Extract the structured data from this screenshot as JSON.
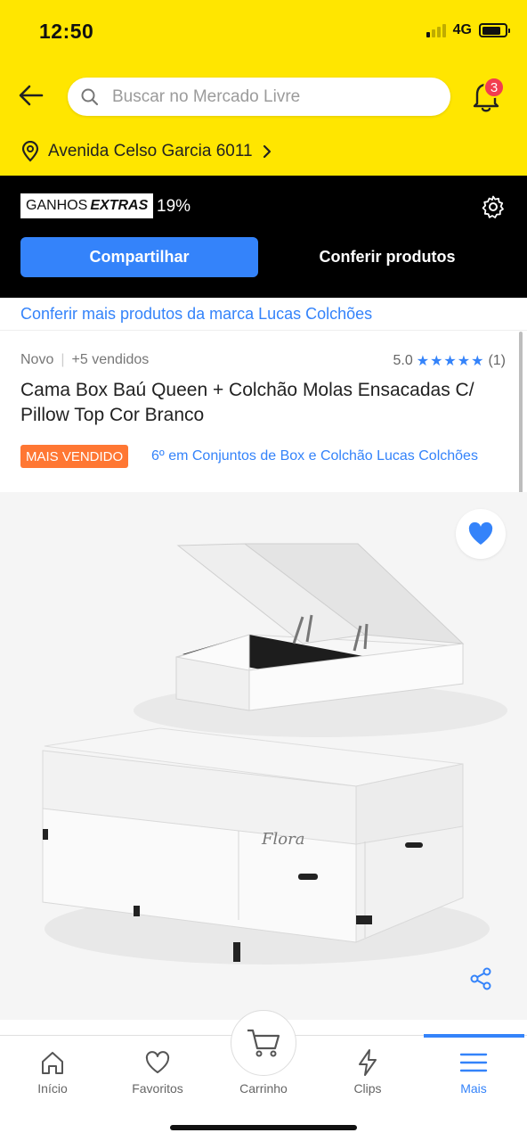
{
  "status": {
    "time": "12:50",
    "network": "4G"
  },
  "header": {
    "search_placeholder": "Buscar no Mercado Livre",
    "notifications_count": "3",
    "address": "Avenida Celso Garcia 6011"
  },
  "affiliate": {
    "ganhos": "GANHOS",
    "extras": "EXTRAS",
    "percent": "19%",
    "share_label": "Compartilhar",
    "check_label": "Conferir produtos"
  },
  "product": {
    "brand_link": "Conferir mais produtos da marca Lucas Colchões",
    "condition": "Novo",
    "sold": "+5 vendidos",
    "rating": "5.0",
    "stars": "★★★★★",
    "reviews": "(1)",
    "title": "Cama Box Baú Queen + Colchão Molas Ensacadas C/ Pillow Top Cor Branco",
    "tag": "MAIS VENDIDO",
    "rank": "6º em Conjuntos de Box e Colchão Lucas Colchões",
    "mattress_label": "Flora"
  },
  "tabs": [
    {
      "label": "Início",
      "icon": "home-icon"
    },
    {
      "label": "Favoritos",
      "icon": "heart-icon"
    },
    {
      "label": "Carrinho",
      "icon": "cart-icon"
    },
    {
      "label": "Clips",
      "icon": "clips-icon"
    },
    {
      "label": "Mais",
      "icon": "menu-icon"
    }
  ],
  "colors": {
    "yellow": "#ffe600",
    "accent": "#3483fa",
    "badge": "#f23d4f",
    "tag": "#ff7733"
  }
}
